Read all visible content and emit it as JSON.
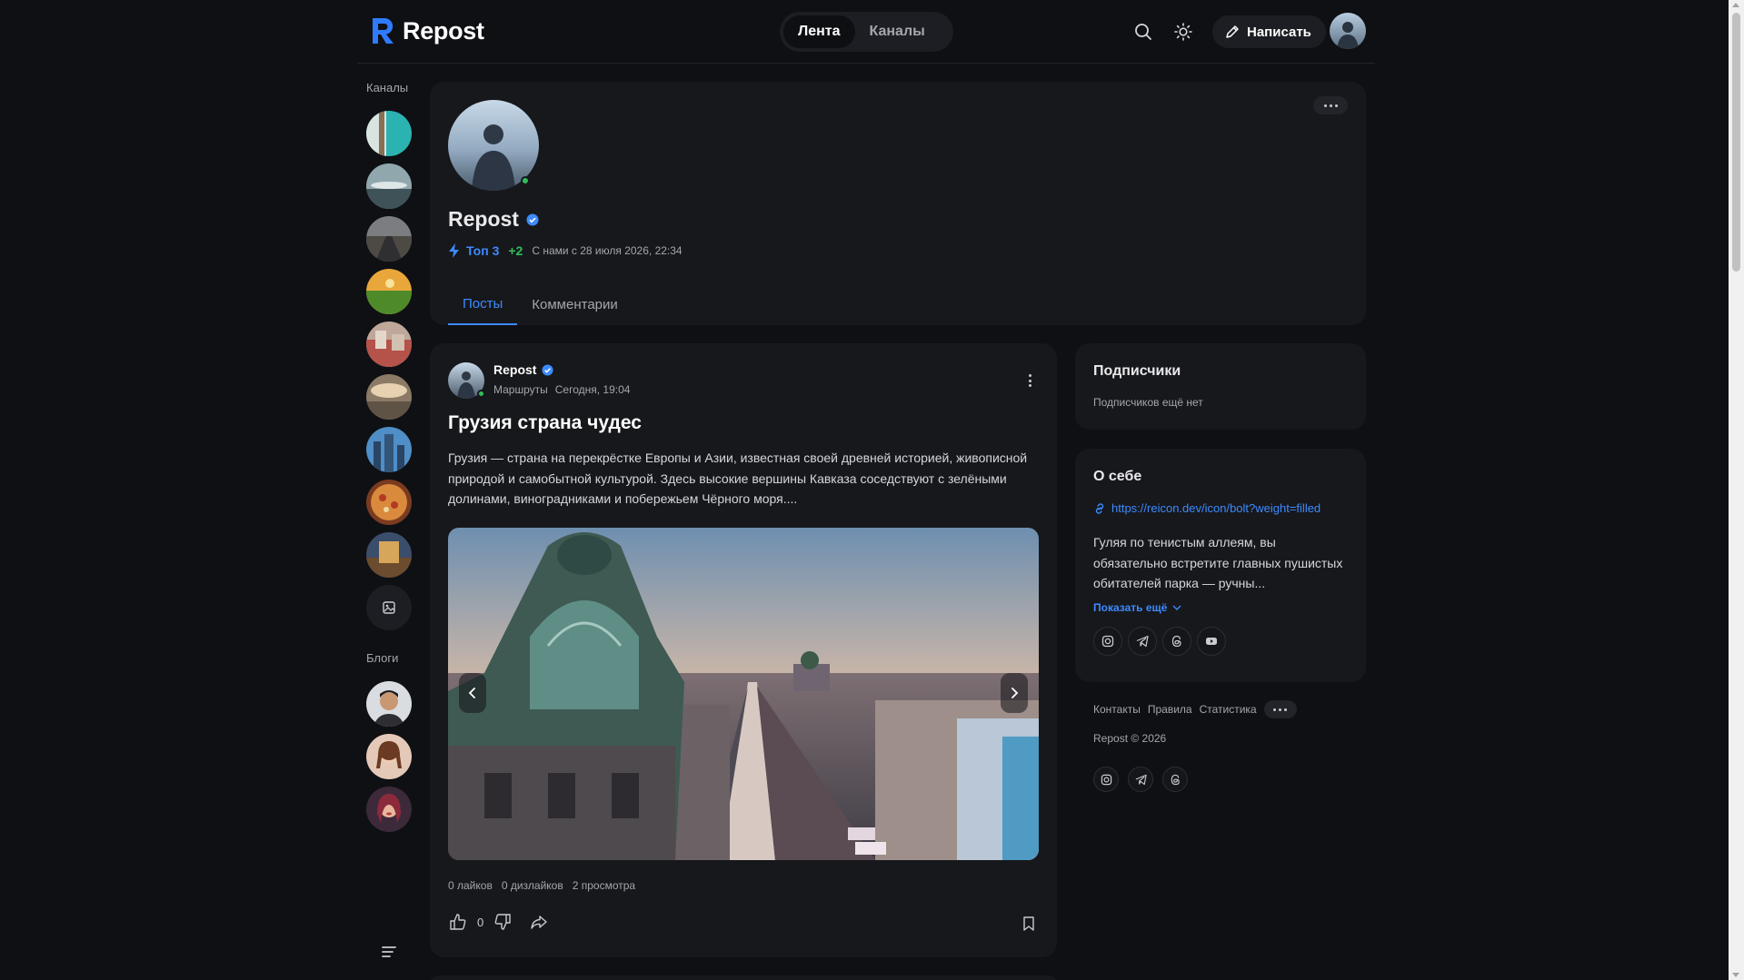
{
  "brand": {
    "name": "Repost",
    "accent": "#3d8bff"
  },
  "nav": {
    "tabs": [
      "Лента",
      "Каналы"
    ],
    "active": 0
  },
  "header": {
    "search_icon": "search-icon",
    "theme_icon": "sun-icon",
    "write_label": "Написать"
  },
  "rail": {
    "channels_title": "Каналы",
    "blogs_title": "Блоги"
  },
  "profile": {
    "name": "Repost",
    "verified": true,
    "top_label": "Топ 3",
    "plus": "+2",
    "since": "С нами с 28 июля 2026, 22:34",
    "tabs": [
      "Посты",
      "Комментарии"
    ],
    "active_tab": 0
  },
  "post": {
    "author": "Repost",
    "channel": "Маршруты",
    "time": "Сегодня, 19:04",
    "title": "Грузия страна чудес",
    "text": "Грузия — страна на перекрёстке Европы и Азии, известная своей древней историей, живописной природой и самобытной культурой. Здесь высокие вершины Кавказа соседствуют с зелёными долинами, виноградниками и побережьем Чёрного моря....",
    "stats": {
      "likes": "0 лайков",
      "dislikes": "0 дизлайков",
      "views": "2 просмотра"
    },
    "like_count": "0"
  },
  "subscribers": {
    "title": "Подписчики",
    "empty": "Подписчиков ещё нет"
  },
  "about": {
    "title": "О себе",
    "link": "https://reicon.dev/icon/bolt?weight=filled",
    "text": "Гуляя по тенистым аллеям, вы обязательно встретите главных пушистых обитателей парка — ручны...",
    "show_more": "Показать ещё",
    "socials": [
      "instagram-icon",
      "telegram-icon",
      "threads-icon",
      "youtube-icon"
    ]
  },
  "footer": {
    "links": [
      "Контакты",
      "Правила",
      "Статистика"
    ],
    "copyright": "Repost © 2026",
    "socials": [
      "instagram-icon",
      "telegram-icon",
      "threads-icon"
    ]
  }
}
